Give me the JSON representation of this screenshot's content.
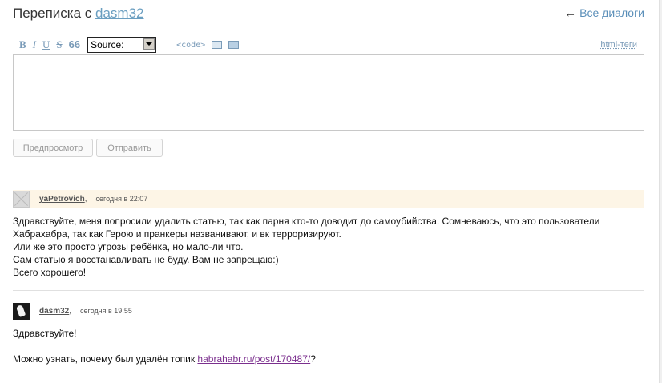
{
  "header": {
    "title_prefix": "Переписка с",
    "user": "dasm32",
    "back_arrow": "←",
    "all_dialogs": "Все диалоги"
  },
  "toolbar": {
    "bold": "B",
    "italic": "I",
    "underline": "U",
    "strike": "S",
    "quote": "66",
    "source_select": "Source:",
    "code": "<code>",
    "html_tags": "html-теги"
  },
  "editor": {
    "value": ""
  },
  "buttons": {
    "preview": "Предпросмотр",
    "send": "Отправить"
  },
  "messages": [
    {
      "author": "yaPetrovich",
      "date": "сегодня в 22:07",
      "lines": [
        "Здравствуйте, меня попросили удалить статью, так как парня кто-то доводит до самоубийства. Сомневаюсь, что это пользователи Хабрахабра, так как Герою и пранкеры названивают, и вк терроризируют.",
        "Или же это просто угрозы ребёнка, но мало-ли что.",
        "Сам статью я восстанавливать не буду. Вам не запрещаю:)",
        "Всего хорошего!"
      ]
    },
    {
      "author": "dasm32",
      "date": "сегодня в 19:55",
      "greeting": "Здравствуйте!",
      "question_prefix": "Можно узнать, почему был удалён топик ",
      "link": "habrahabr.ru/post/170487/",
      "question_suffix": "?"
    }
  ],
  "colors": {
    "link": "#5b8fb9",
    "visited_link": "#7b2f8e",
    "highlight": "#fdf5e6"
  }
}
